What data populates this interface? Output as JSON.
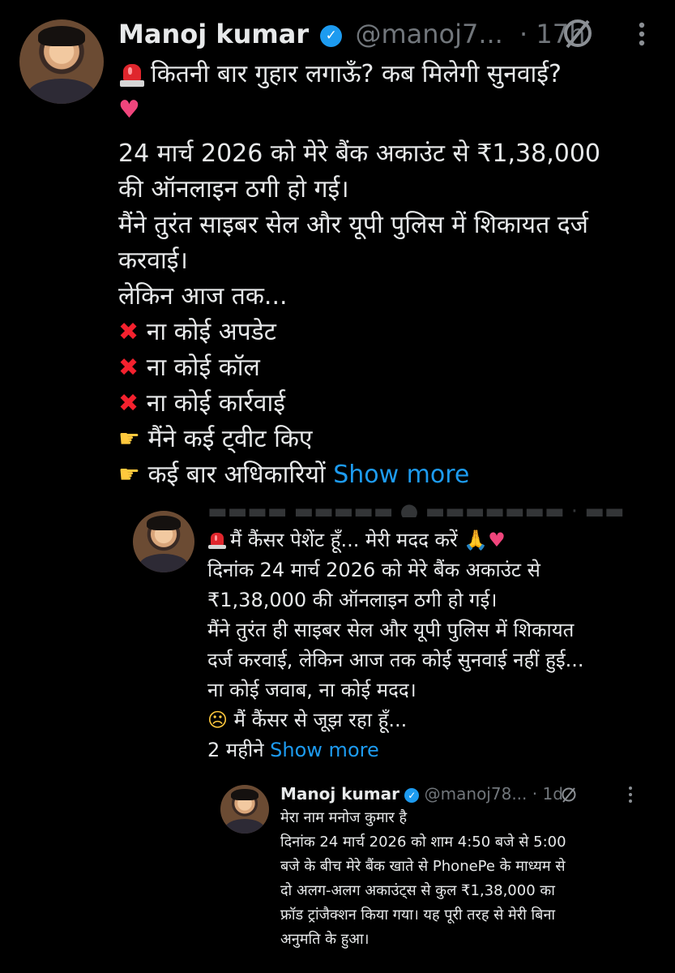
{
  "post": {
    "author": "Manoj kumar",
    "handle": "@manoj7...",
    "time": "· 17h",
    "lines": [
      "कितनी बार गुहार लगाऊँ? कब मिलेगी सुनवाई?",
      "24 मार्च 2026 को मेरे बैंक अकाउंट से ₹1,38,000",
      "की ऑनलाइन ठगी हो गई।",
      "मैंने तुरंत साइबर सेल और यूपी पुलिस में शिकायत दर्ज",
      "करवाई।",
      "लेकिन आज तक...",
      "ना कोई अपडेट",
      "ना कोई कॉल",
      "ना कोई कार्रवाई",
      "मैंने कई ट्वीट किए",
      "कई बार अधिकारियों"
    ],
    "show_more": "Show more"
  },
  "quote1": {
    "lines": [
      "मैं कैंसर पेशेंट हूँ... मेरी मदद करें",
      "दिनांक 24 मार्च 2026 को मेरे बैंक अकाउंट से",
      "₹1,38,000 की ऑनलाइन ठगी हो गई।",
      "मैंने तुरंत ही साइबर सेल और यूपी पुलिस में शिकायत",
      "दर्ज करवाई, लेकिन आज तक कोई सुनवाई नहीं हुई...",
      "ना कोई जवाब, ना कोई मदद।",
      "मैं कैंसर से जूझ रहा हूँ...",
      "2 महीने"
    ],
    "show_more": "Show more"
  },
  "quote2": {
    "author": "Manoj kumar",
    "handle": "@manoj78...",
    "time": "· 1d",
    "lines": [
      "मेरा नाम मनोज कुमार है",
      "दिनांक 24 मार्च 2026 को शाम 4:50 बजे से 5:00",
      "बजे के बीच मेरे बैंक खाते से PhonePe के माध्यम से",
      "दो अलग-अलग अकाउंट्स से कुल ₹1,38,000 का",
      "फ्रॉड ट्रांजैक्शन किया गया। यह पूरी तरह से मेरी बिना",
      "अनुमति के हुआ।"
    ]
  },
  "icons": {
    "verified": "verified-badge-icon",
    "grok": "grok-icon",
    "more": "more-icon",
    "siren": "siren-icon",
    "broken_heart": "broken-heart-icon",
    "cross": "cross-mark-icon",
    "pointing_hand": "pointing-hand-icon",
    "folded_hands": "folded-hands-icon",
    "pensive": "pensive-face-icon"
  },
  "colors": {
    "link": "#1d9bf0",
    "verified": "#1d9bf0",
    "cross": "#f4212e",
    "muted": "#71767b",
    "background": "#000000"
  }
}
